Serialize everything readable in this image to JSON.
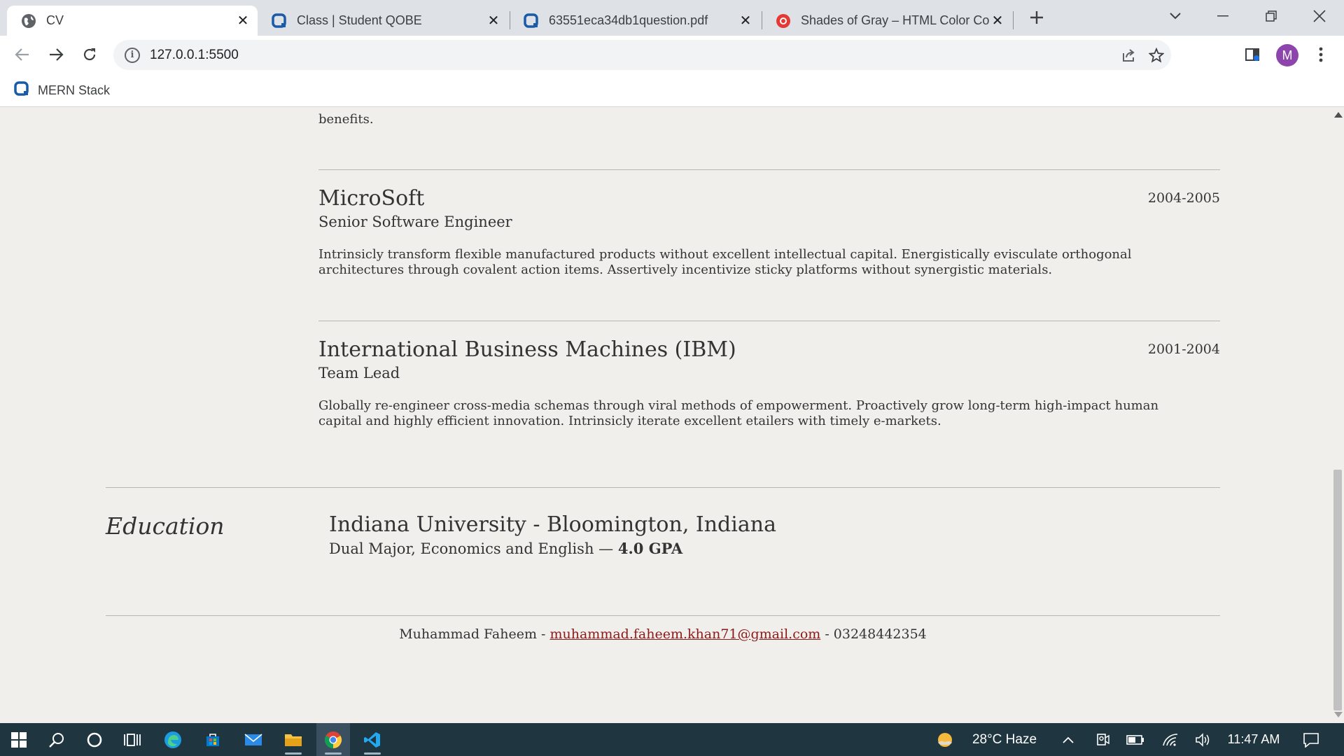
{
  "browser": {
    "tabs": [
      {
        "title": "CV",
        "icon": "globe-icon",
        "active": true
      },
      {
        "title": "Class | Student QOBE",
        "icon": "qobe-icon",
        "active": false
      },
      {
        "title": "63551eca34db1question.pdf",
        "icon": "qobe-icon",
        "active": false
      },
      {
        "title": "Shades of Gray – HTML Color Co",
        "icon": "color-codes-icon",
        "active": false
      }
    ],
    "url": "127.0.0.1:5500",
    "profile_initial": "M",
    "bookmark_label": "MERN Stack"
  },
  "page": {
    "cut_text": "benefits.",
    "experience": [
      {
        "company": "MicroSoft",
        "years": "2004-2005",
        "role": "Senior Software Engineer",
        "description": "Intrinsicly transform flexible manufactured products without excellent intellectual capital. Energistically evisculate orthogonal architectures through covalent action items. Assertively incentivize sticky platforms without synergistic materials."
      },
      {
        "company": "International Business Machines (IBM)",
        "years": "2001-2004",
        "role": "Team Lead",
        "description": "Globally re-engineer cross-media schemas through viral methods of empowerment. Proactively grow long-term high-impact human capital and highly efficient innovation. Intrinsicly iterate excellent etailers with timely e-markets."
      }
    ],
    "education": {
      "section_title": "Education",
      "school": "Indiana University - Bloomington, Indiana",
      "degree": "Dual Major, Economics and English —",
      "gpa": "4.0 GPA"
    },
    "footer": {
      "name": "Muhammad Faheem - ",
      "email": "muhammad.faheem.khan71@gmail.com",
      "phone": " - 03248442354"
    }
  },
  "taskbar": {
    "weather": "28°C  Haze",
    "time": "11:47 AM"
  }
}
